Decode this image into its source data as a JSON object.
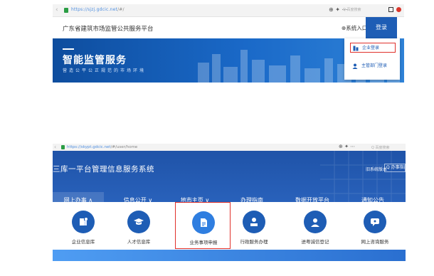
{
  "colors": {
    "primary": "#1e5db5",
    "highlight": "#e0312b",
    "banner": "#1a69c8"
  },
  "top_browser": {
    "url_prefix": "https://",
    "url_host": "sjzj.gdcic.net",
    "url_path": "/#/",
    "tools_label": "⊕ ✦ ⋯",
    "search_placeholder": "Q 百度搜索"
  },
  "top_site": {
    "title": "广东省建筑市场监管公共服务平台",
    "system_entry": "⊕系统入口",
    "login_label": "登录",
    "banner_title": "智能监管服务",
    "banner_subtitle": "营造公平公正规范的市场环境",
    "dropdown": [
      {
        "label": "企业登录",
        "icon": "building-icon",
        "highlighted": true
      },
      {
        "label": "主管部门登录",
        "icon": "user-icon",
        "highlighted": false
      }
    ]
  },
  "bottom_browser": {
    "url_prefix": "https://",
    "url_host": "skypt.gdcic.net",
    "url_path": "/#/user/home",
    "tools_label": "⊕ ✦ ⋯",
    "search_placeholder": "Q 百度搜索"
  },
  "bottom_site": {
    "system_title": "三库一平台管理信息服务系统",
    "old_version_label": "旧系统版本",
    "search_label": "Q 办事指南",
    "nav": [
      {
        "label": "网上办事 ∧",
        "active": true
      },
      {
        "label": "信息公开 ∨",
        "active": false
      },
      {
        "label": "地市主页 ∨",
        "active": false
      },
      {
        "label": "办理指南",
        "active": false
      },
      {
        "label": "数据开放平台",
        "active": false
      },
      {
        "label": "通知公告",
        "active": false
      }
    ],
    "services": [
      {
        "label": "企业信息库",
        "icon": "enterprise-icon",
        "highlighted": false
      },
      {
        "label": "人才信息库",
        "icon": "graduation-cap-icon",
        "highlighted": false
      },
      {
        "label": "业务事项申报",
        "icon": "document-declare-icon",
        "highlighted": true
      },
      {
        "label": "行政服务办理",
        "icon": "admin-service-icon",
        "highlighted": false
      },
      {
        "label": "进粤诚信登记",
        "icon": "person-register-icon",
        "highlighted": false
      },
      {
        "label": "网上咨询服务",
        "icon": "consult-icon",
        "highlighted": false
      }
    ]
  }
}
